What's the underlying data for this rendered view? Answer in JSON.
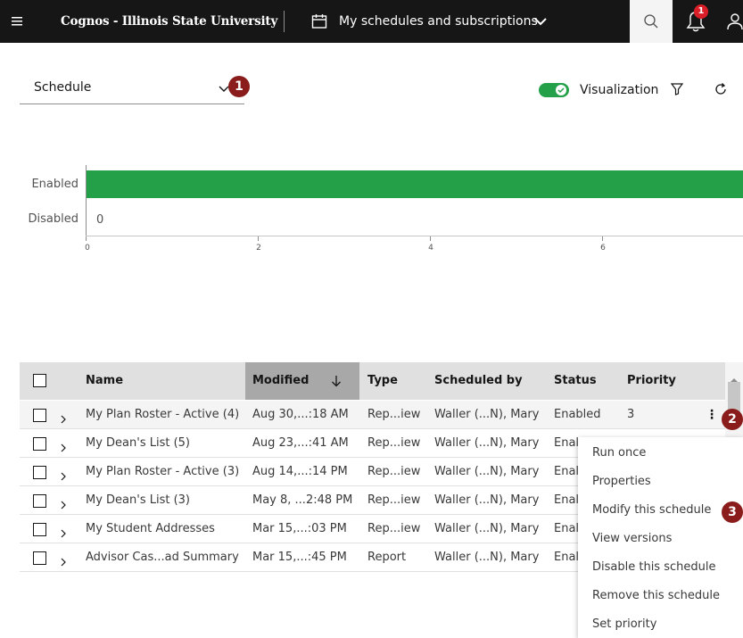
{
  "topbar": {
    "app_title": "Cognos - Illinois State University",
    "page_title": "My schedules and subscriptions",
    "notification_count": "1"
  },
  "filter": {
    "dropdown_value": "Schedule",
    "visualization_label": "Visualization",
    "visualization_on": true
  },
  "callouts": [
    "1",
    "2",
    "3"
  ],
  "chart_data": {
    "type": "bar",
    "orientation": "horizontal",
    "categories": [
      "Enabled",
      "Disabled"
    ],
    "values": [
      8,
      0
    ],
    "value_labels": [
      "",
      "0"
    ],
    "x_ticks": [
      "0",
      "2",
      "4",
      "6"
    ],
    "xlim": [
      0,
      8
    ],
    "bar_color": "#24a148"
  },
  "table": {
    "columns": [
      "Name",
      "Modified",
      "Type",
      "Scheduled by",
      "Status",
      "Priority"
    ],
    "rows": [
      {
        "name": "My Plan Roster - Active (4)",
        "modified": "Aug 30,...:18 AM",
        "type": "Rep...iew",
        "scheduled_by": "Waller (...N), Mary",
        "status": "Enabled",
        "priority": "3"
      },
      {
        "name": "My Dean's List (5)",
        "modified": "Aug 23,...:41 AM",
        "type": "Rep...iew",
        "scheduled_by": "Waller (...N), Mary",
        "status": "Enal",
        "priority": ""
      },
      {
        "name": "My Plan Roster - Active (3)",
        "modified": "Aug 14,...:14 PM",
        "type": "Rep...iew",
        "scheduled_by": "Waller (...N), Mary",
        "status": "Enal",
        "priority": ""
      },
      {
        "name": "My Dean's List (3)",
        "modified": "May 8, ...2:48 PM",
        "type": "Rep...iew",
        "scheduled_by": "Waller (...N), Mary",
        "status": "Enal",
        "priority": ""
      },
      {
        "name": "My Student Addresses",
        "modified": "Mar 15,...:03 PM",
        "type": "Rep...iew",
        "scheduled_by": "Waller (...N), Mary",
        "status": "Enal",
        "priority": ""
      },
      {
        "name": "Advisor Cas...ad Summary",
        "modified": "Mar 15,...:45 PM",
        "type": "Report",
        "scheduled_by": "Waller (...N), Mary",
        "status": "Enal",
        "priority": ""
      }
    ]
  },
  "context_menu": {
    "items": [
      "Run once",
      "Properties",
      "Modify this schedule",
      "View versions",
      "Disable this schedule",
      "Remove this schedule",
      "Set priority"
    ]
  },
  "colors": {
    "topbar": "#161616",
    "accent_green": "#24a148",
    "callout": "#8a1c1c",
    "notification": "#da1e28"
  }
}
